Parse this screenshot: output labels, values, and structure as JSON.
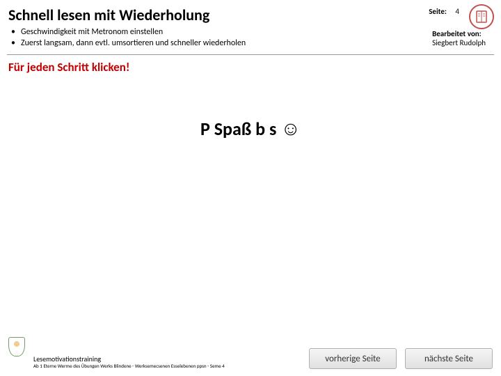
{
  "header": {
    "title": "Schnell lesen mit Wiederholung",
    "bullets": [
      "Geschwindigkeit mit Metronom einstellen",
      "Zuerst langsam, dann evtl. umsortieren und schneller wiederholen"
    ]
  },
  "page": {
    "label": "Seite:",
    "number": "4"
  },
  "author": {
    "label": "Bearbeitet von:",
    "name": "Siegbert Rudolph"
  },
  "hint": "Für jeden Schritt klicken!",
  "center": {
    "garble_top": "",
    "garble_main": "P Spaß b s"
  },
  "footer": {
    "caption_line1": "Lesemotivationstraining",
    "caption_line2": "Ab 1  Eterne Werme des  Übungen Werks Blindene  - Werksemecsenen  Esselebenen ppsn - Seme 4"
  },
  "nav": {
    "prev": "vorherige Seite",
    "next": "nächste Seite"
  }
}
